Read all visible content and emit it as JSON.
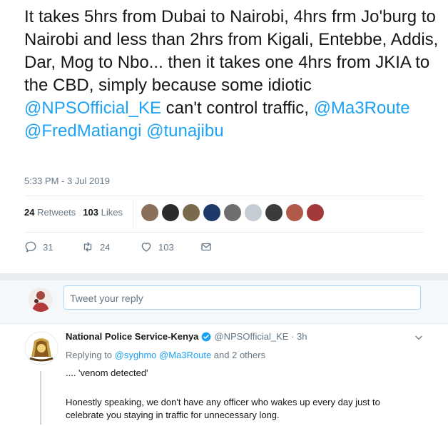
{
  "tweet": {
    "text_parts": [
      "It takes 5hrs from Dubai to Nairobi, 4hrs frm Jo'burg to Nairobi and less than 2hrs from Kigali, Entebbe, Addis, Dar, Mog to Nbo... then it takes one 4hrs from JKIA to the CBD, simply because some idiotic ",
      "@NPSOfficial_KE",
      " can't control traffic, ",
      "@Ma3Route",
      " ",
      "@FredMatiangi",
      " ",
      "@tunajibu"
    ],
    "timestamp": "5:33 PM - 3 Jul 2019",
    "retweets_count": "24",
    "retweets_label": "Retweets",
    "likes_count": "103",
    "likes_label": "Likes",
    "liker_avatars": [
      {
        "name": "liker-avatar-1",
        "color": "#8a6f5a"
      },
      {
        "name": "liker-avatar-2",
        "color": "#2b2b2b"
      },
      {
        "name": "liker-avatar-3",
        "color": "#7a6a4c"
      },
      {
        "name": "liker-avatar-4",
        "color": "#1d3a6b"
      },
      {
        "name": "liker-avatar-5",
        "color": "#6f6f6f"
      },
      {
        "name": "liker-avatar-6",
        "color": "#c5ccd3"
      },
      {
        "name": "liker-avatar-7",
        "color": "#3b3b3b"
      },
      {
        "name": "liker-avatar-8",
        "color": "#b25a4a"
      },
      {
        "name": "liker-avatar-9",
        "color": "#a33a3a"
      }
    ],
    "actions": {
      "reply_count": "31",
      "retweet_count": "24",
      "like_count": "103"
    }
  },
  "compose": {
    "placeholder": "Tweet your reply"
  },
  "reply": {
    "name": "National Police Service-Kenya",
    "handle_time": "@NPSOfficial_KE · 3h",
    "replying_prefix": "Replying to ",
    "replying_user1": "@syghmo",
    "replying_user2": "@Ma3Route",
    "replying_suffix": " and 2 others",
    "text1": ".... 'venom detected'",
    "text2": "Honestly speaking, we don't have any officer who wakes up every day just to celebrate you staying in traffic for unnecessary long."
  },
  "colors": {
    "accent": "#1da1f2",
    "muted": "#657786",
    "divider": "#e6ecf0"
  }
}
